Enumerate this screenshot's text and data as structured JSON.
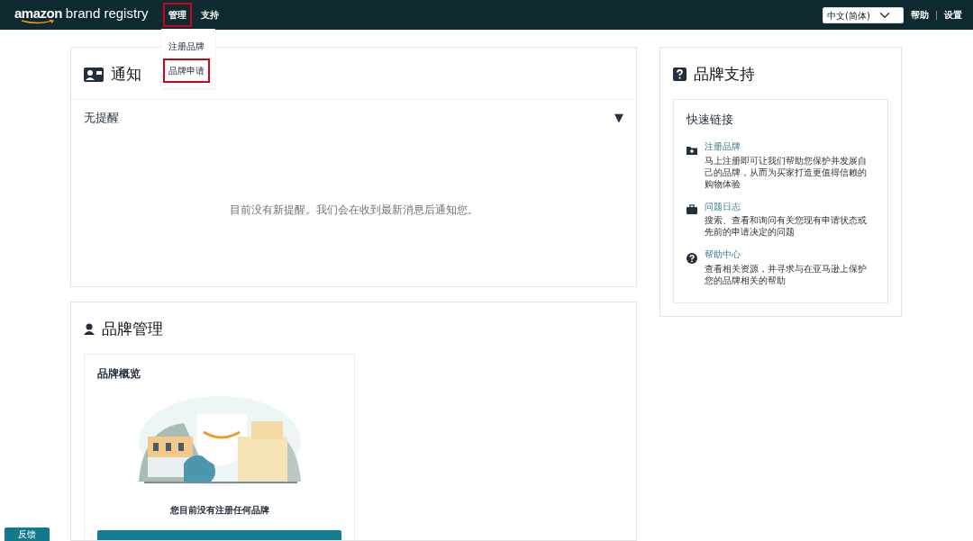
{
  "header": {
    "logo": {
      "brand": "amazon",
      "product": "brand registry"
    },
    "nav": [
      {
        "label": "管理",
        "highlighted": true,
        "menu": [
          {
            "label": "注册品牌",
            "highlighted": false
          },
          {
            "label": "品牌申请",
            "highlighted": true
          }
        ]
      },
      {
        "label": "支持",
        "highlighted": false
      }
    ],
    "language": "中文(简体)",
    "links": [
      "帮助",
      "设置"
    ]
  },
  "notifications": {
    "title": "通知",
    "filter": {
      "label": "无提醒",
      "caret": "▼"
    },
    "empty_message": "目前没有新提醒。我们会在收到最新消息后通知您。"
  },
  "brand_support": {
    "title": "品牌支持",
    "quick_links": {
      "title": "快速链接",
      "items": [
        {
          "kind": "add-folder",
          "label": "注册品牌",
          "description": "马上注册即可让我们帮助您保护并发展自己的品牌，从而为买家打造更值得信赖的购物体验"
        },
        {
          "kind": "briefcase",
          "label": "问题日志",
          "description": "搜索、查看和询问有关您现有申请状态或先前的申请决定的问题"
        },
        {
          "kind": "help",
          "label": "帮助中心",
          "description": "查看相关资源，并寻求与在亚马逊上保护您的品牌相关的帮助"
        }
      ]
    }
  },
  "brand_management": {
    "title": "品牌管理",
    "overview": {
      "title": "品牌概览",
      "message": "您目前没有注册任何品牌"
    }
  },
  "feedback_button": "反馈"
}
